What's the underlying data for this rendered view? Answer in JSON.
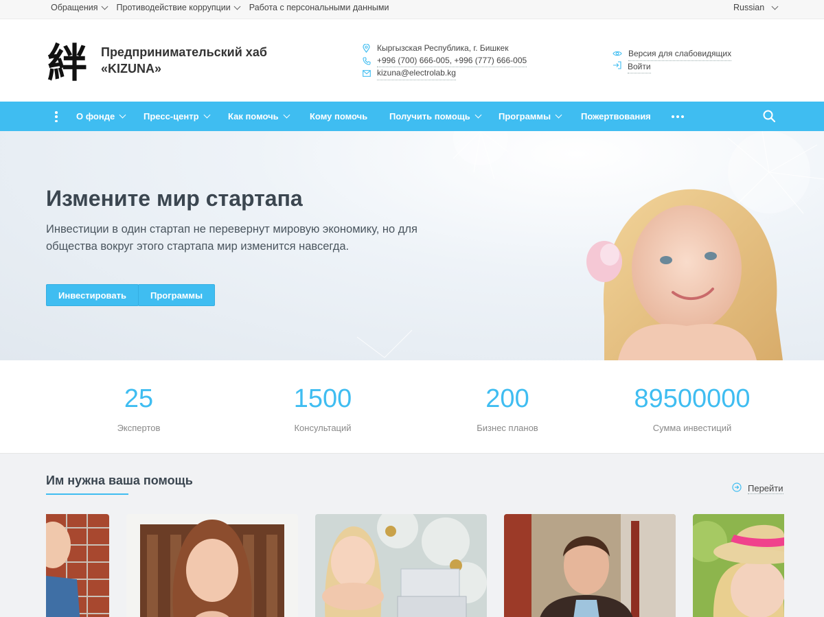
{
  "topbar": {
    "links": [
      "Обращения",
      "Противодействие коррупции",
      "Работа с персональными данными"
    ],
    "language": "Russian"
  },
  "header": {
    "logo_glyph": "絆",
    "brand_line1": "Предпринимательский хаб",
    "brand_line2": "«KIZUNA»",
    "address": "Кыргызская Республика, г. Бишкек",
    "phones": "+996 (700) 666-005,  +996 (777) 666-005",
    "email": "kizuna@electrolab.kg",
    "accessibility_label": "Версия для слабовидящих",
    "login_label": "Войти"
  },
  "nav": {
    "items": [
      {
        "label": "О фонде"
      },
      {
        "label": "Пресс-центр"
      },
      {
        "label": "Как помочь"
      },
      {
        "label": "Кому помочь"
      },
      {
        "label": "Получить помощь"
      },
      {
        "label": "Программы"
      },
      {
        "label": "Пожертвования"
      }
    ]
  },
  "hero": {
    "title": "Измените мир стартапа",
    "text": "Инвестиции в один стартап не перевернут мировую экономику, но для общества вокруг этого стартапа мир изменится навсегда.",
    "btn_invest": "Инвестировать",
    "btn_programs": "Программы"
  },
  "stats": [
    {
      "value": "25",
      "label": "Экспертов"
    },
    {
      "value": "1500",
      "label": "Консультаций"
    },
    {
      "value": "200",
      "label": "Бизнес планов"
    },
    {
      "value": "89500000",
      "label": "Сумма инвестиций"
    }
  ],
  "help": {
    "title": "Им нужна ваша помощь",
    "goto_label": "Перейти"
  },
  "colors": {
    "accent": "#3fbdf1",
    "text_dark": "#3b4650"
  },
  "icons": {
    "address": "map-pin-icon",
    "phone": "phone-icon",
    "email": "mail-icon",
    "accessibility": "eye-icon",
    "login": "sign-in-icon",
    "search": "search-icon"
  }
}
